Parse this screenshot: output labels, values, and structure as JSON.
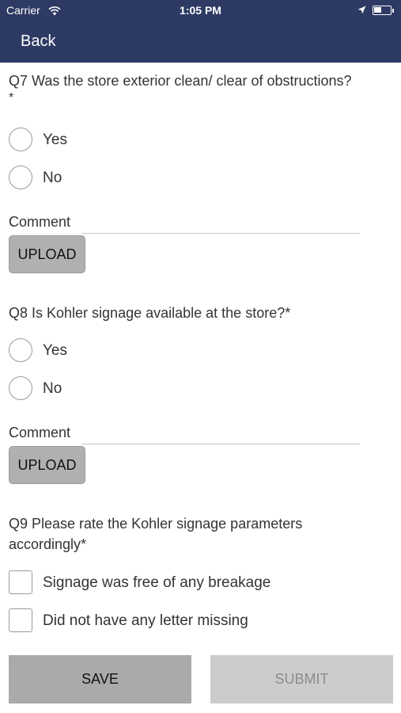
{
  "status_bar": {
    "carrier": "Carrier",
    "time": "1:05 PM",
    "battery_level": 0.45,
    "icons": [
      "wifi-icon",
      "location-arrow-icon",
      "battery-icon"
    ]
  },
  "nav": {
    "back_label": "Back",
    "background": "#2d3a63"
  },
  "questions": {
    "q7": {
      "text": "Q7 Was the store exterior clean/ clear of obstructions?",
      "required_mark": "*",
      "options": [
        "Yes",
        "No"
      ],
      "comment_label": "Comment",
      "comment_value": "",
      "upload_label": "UPLOAD"
    },
    "q8": {
      "text": "Q8 Is Kohler signage available at the store?*",
      "options": [
        "Yes",
        "No"
      ],
      "comment_label": "Comment",
      "comment_value": "",
      "upload_label": "UPLOAD"
    },
    "q9": {
      "text_line1": "Q9 Please rate the Kohler signage parameters",
      "text_line2": "accordingly*",
      "options": [
        "Signage was free of any breakage",
        "Did not have any letter missing"
      ]
    }
  },
  "footer": {
    "save_label": "SAVE",
    "submit_label": "SUBMIT"
  }
}
